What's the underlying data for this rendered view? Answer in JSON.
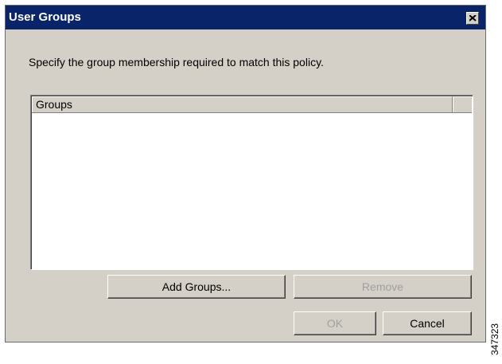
{
  "window": {
    "title": "User Groups",
    "close_icon": "close-icon"
  },
  "main": {
    "instruction": "Specify the group membership required to match this policy."
  },
  "groups_list": {
    "columns": [
      "Groups"
    ],
    "rows": []
  },
  "buttons": {
    "add_groups": "Add Groups...",
    "remove": "Remove",
    "ok": "OK",
    "cancel": "Cancel"
  },
  "figure_id": "347323",
  "colors": {
    "titlebar": "#0a246a",
    "dialog_bg": "#d4d0c8",
    "disabled_text": "#a0a0a0"
  }
}
